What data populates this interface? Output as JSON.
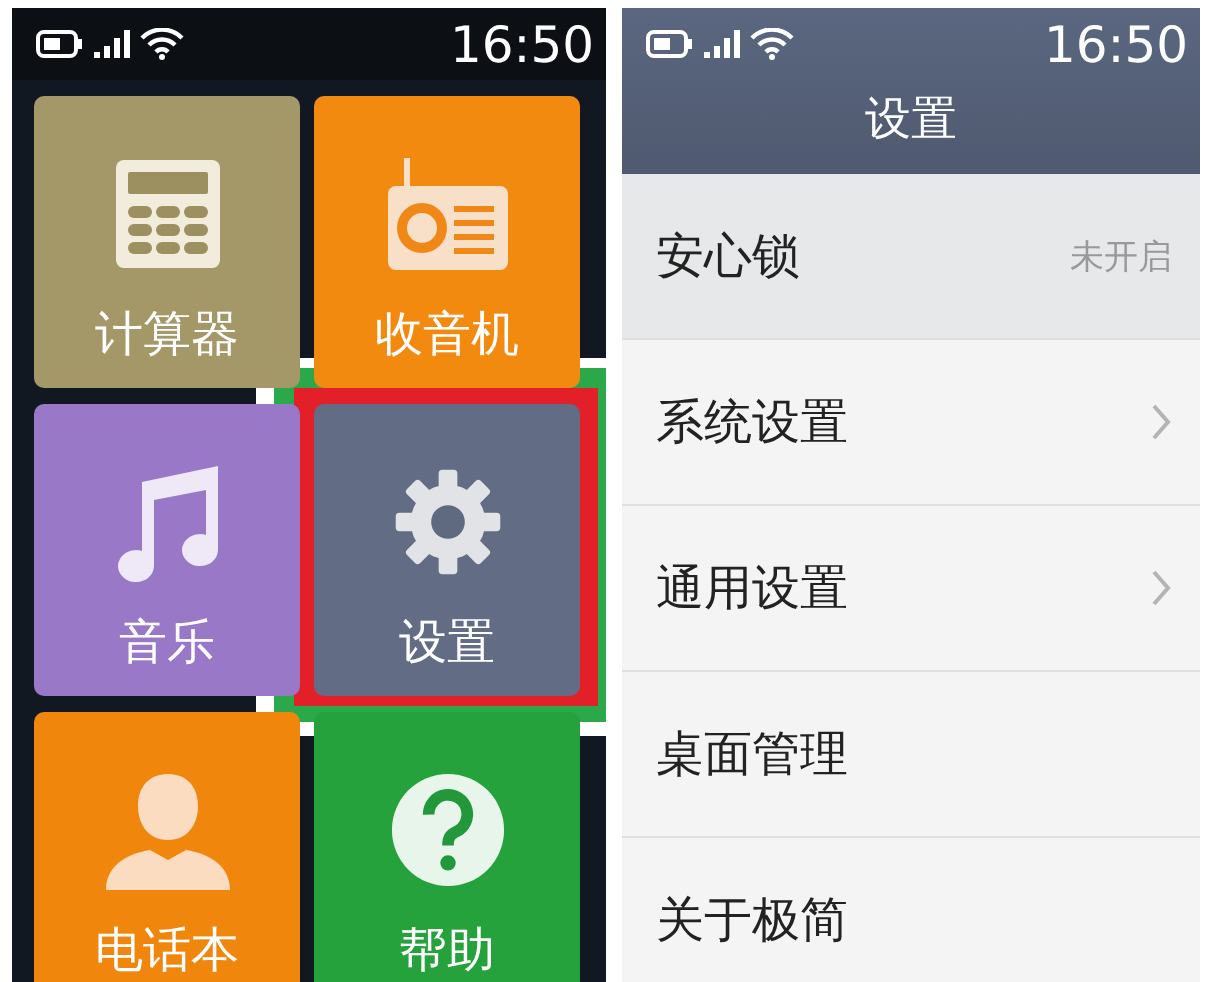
{
  "screens": [
    {
      "kind": "home",
      "status_bar": {
        "time": "16:50"
      },
      "tiles": [
        {
          "label": "计算器",
          "kind": "calculator",
          "color": "#a59868",
          "highlighted": false
        },
        {
          "label": "收音机",
          "kind": "radio",
          "color": "#f38a10",
          "highlighted": false
        },
        {
          "label": "音乐",
          "kind": "music",
          "color": "#9a78c8",
          "highlighted": false
        },
        {
          "label": "设置",
          "kind": "settings",
          "color": "#626c84",
          "highlighted": true
        },
        {
          "label": "电话本",
          "kind": "contacts",
          "color": "#f1860c",
          "highlighted": false
        },
        {
          "label": "帮助",
          "kind": "help",
          "color": "#25a23c",
          "highlighted": false
        }
      ]
    },
    {
      "kind": "settings",
      "status_bar": {
        "time": "16:50"
      },
      "title": "设置",
      "items": [
        {
          "label": "安心锁",
          "value": "未开启",
          "selected": true,
          "arrow": false
        },
        {
          "label": "系统设置",
          "selected": false,
          "arrow": true
        },
        {
          "label": "通用设置",
          "selected": false,
          "arrow": true
        },
        {
          "label": "桌面管理",
          "selected": false,
          "arrow": false
        },
        {
          "label": "关于极简",
          "selected": false,
          "arrow": false
        }
      ]
    }
  ]
}
